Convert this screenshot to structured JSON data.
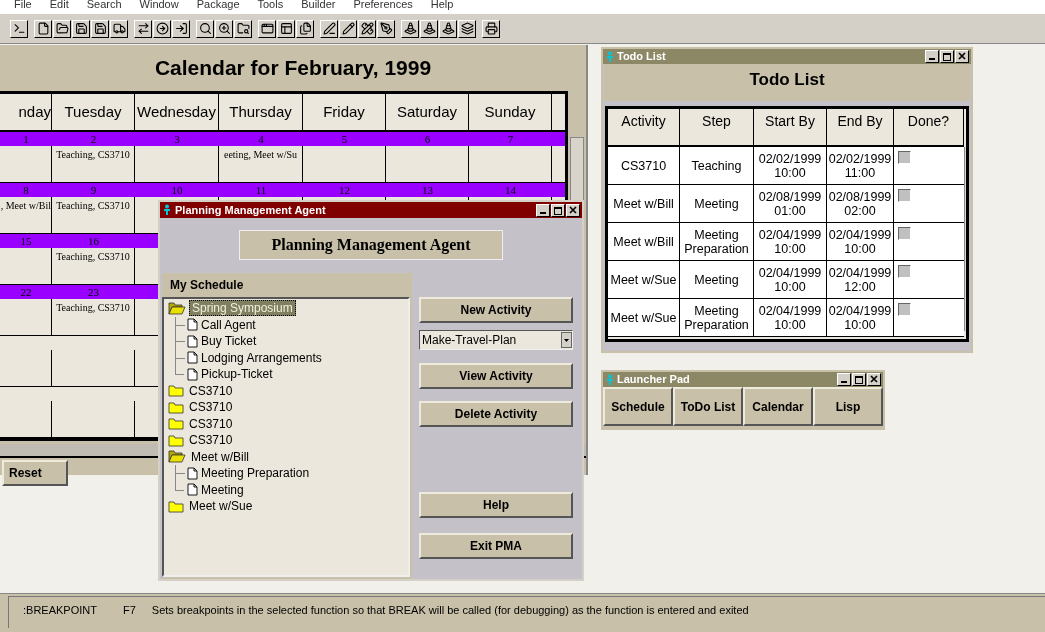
{
  "menu": [
    "File",
    "Edit",
    "Search",
    "Window",
    "Package",
    "Tools",
    "Builder",
    "Preferences",
    "Help"
  ],
  "calendar": {
    "title": "Calendar for February, 1999",
    "days": [
      "nday",
      "Tuesday",
      "Wednesday",
      "Thursday",
      "Friday",
      "Saturday",
      "Sunday"
    ],
    "weeks": [
      {
        "cells": [
          {
            "day": "1"
          },
          {
            "day": "2",
            "event": "Teaching, CS3710"
          },
          {
            "day": "3"
          },
          {
            "day": "4",
            "event": "eeting, Meet w/Su"
          },
          {
            "day": "5"
          },
          {
            "day": "6"
          },
          {
            "day": "7"
          }
        ]
      },
      {
        "cells": [
          {
            "day": "8",
            "event": ", Meet w/Bil"
          },
          {
            "day": "9",
            "event": "Teaching, CS3710"
          },
          {
            "day": "10"
          },
          {
            "day": "11"
          },
          {
            "day": "12"
          },
          {
            "day": "13"
          },
          {
            "day": "14"
          }
        ]
      },
      {
        "cells": [
          {
            "day": "15"
          },
          {
            "day": "16",
            "event": "Teaching, CS3710"
          }
        ]
      },
      {
        "cells": [
          {
            "day": "22"
          },
          {
            "day": "23",
            "event": "Teaching, CS3710"
          }
        ]
      }
    ],
    "reset": "Reset"
  },
  "pma": {
    "title": "Planning Management Agent",
    "heading": "Planning Management Agent",
    "schedule_label": "My Schedule",
    "tree": [
      {
        "label": "Spring Symposium",
        "expanded": true,
        "selected": true,
        "children": [
          {
            "label": "Call Agent"
          },
          {
            "label": "Buy Ticket"
          },
          {
            "label": "Lodging Arrangements"
          },
          {
            "label": "Pickup-Ticket"
          }
        ]
      },
      {
        "label": "CS3710",
        "expanded": false,
        "selected": false
      },
      {
        "label": "CS3710",
        "expanded": false,
        "selected": false
      },
      {
        "label": "CS3710",
        "expanded": false,
        "selected": false
      },
      {
        "label": "CS3710",
        "expanded": false,
        "selected": false
      },
      {
        "label": "Meet w/Bill",
        "expanded": true,
        "selected": false,
        "children": [
          {
            "label": "Meeting Preparation"
          },
          {
            "label": "Meeting"
          }
        ]
      },
      {
        "label": "Meet w/Sue",
        "expanded": false,
        "selected": false
      }
    ],
    "new_button": "New Activity",
    "dropdown": {
      "value": "Make-Travel-Plan"
    },
    "actions": [
      "View Activity",
      "Delete Activity"
    ],
    "footer_buttons": [
      "Help",
      "Exit PMA"
    ]
  },
  "todo": {
    "title": "Todo List",
    "heading": "Todo List",
    "columns": [
      "Activity",
      "Step",
      "Start By",
      "End By",
      "Done?"
    ],
    "rows": [
      {
        "activity": "CS3710",
        "step": "Teaching",
        "start": "02/02/1999 10:00",
        "end": "02/02/1999 11:00",
        "done": false
      },
      {
        "activity": "Meet w/Bill",
        "step": "Meeting",
        "start": "02/08/1999 01:00",
        "end": "02/08/1999 02:00",
        "done": false
      },
      {
        "activity": "Meet w/Bill",
        "step": "Meeting Preparation",
        "start": "02/04/1999 10:00",
        "end": "02/04/1999 10:00",
        "done": false
      },
      {
        "activity": "Meet w/Sue",
        "step": "Meeting",
        "start": "02/04/1999 10:00",
        "end": "02/04/1999 12:00",
        "done": false
      },
      {
        "activity": "Meet w/Sue",
        "step": "Meeting Preparation",
        "start": "02/04/1999 10:00",
        "end": "02/04/1999 10:00",
        "done": false
      }
    ]
  },
  "launcher": {
    "title": "Launcher Pad",
    "buttons": [
      "Schedule",
      "ToDo List",
      "Calendar",
      "Lisp"
    ]
  },
  "status_bar": {
    "command": ":BREAKPOINT",
    "key": "F7",
    "description": "Sets breakpoints in the selected function so that BREAK will be called (for debugging) as the function is entered and exited"
  }
}
